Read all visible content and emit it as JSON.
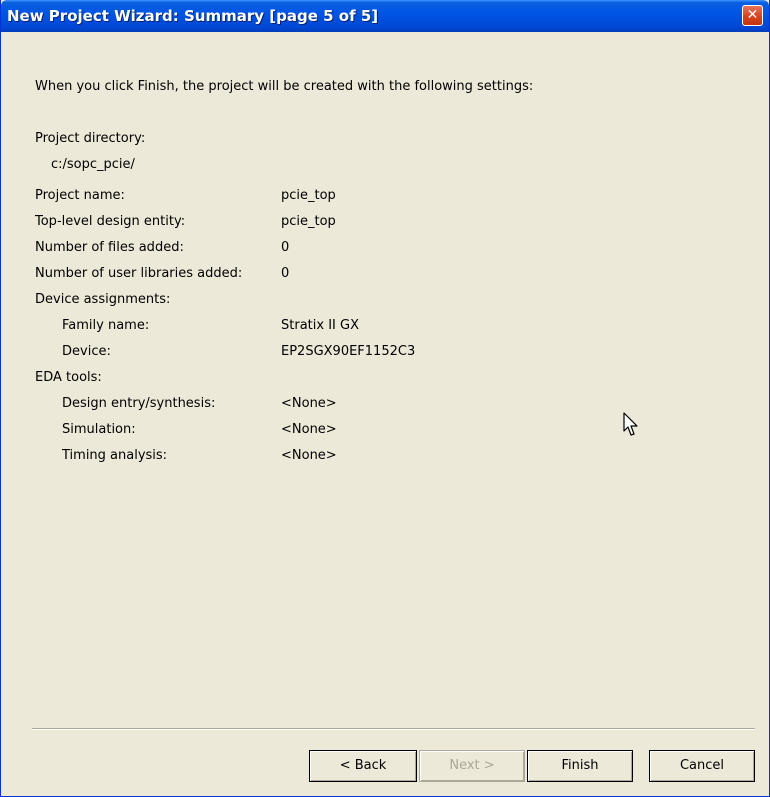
{
  "window": {
    "title": "New Project Wizard: Summary [page 5 of 5]",
    "close_glyph": "✕"
  },
  "summary": {
    "intro": "When you click Finish, the project will be created with the following settings:",
    "project_directory_label": "Project directory:",
    "project_directory_value": "c:/sopc_pcie/",
    "project_name_label": "Project name:",
    "project_name_value": "pcie_top",
    "top_level_label": "Top-level design entity:",
    "top_level_value": "pcie_top",
    "files_added_label": "Number of files added:",
    "files_added_value": "0",
    "user_libraries_label": "Number of user libraries added:",
    "user_libraries_value": "0",
    "device_assignments_label": "Device assignments:",
    "family_name_label": "Family name:",
    "family_name_value": "Stratix II GX",
    "device_label": "Device:",
    "device_value": "EP2SGX90EF1152C3",
    "eda_tools_label": "EDA tools:",
    "design_entry_label": "Design entry/synthesis:",
    "design_entry_value": "<None>",
    "simulation_label": "Simulation:",
    "simulation_value": "<None>",
    "timing_label": "Timing analysis:",
    "timing_value": "<None>"
  },
  "buttons": {
    "back": "< Back",
    "next": "Next >",
    "finish": "Finish",
    "cancel": "Cancel"
  },
  "colors": {
    "titlebar": "#0055e5",
    "dialog_background": "#ece9d8",
    "disabled_text": "#aca899"
  }
}
